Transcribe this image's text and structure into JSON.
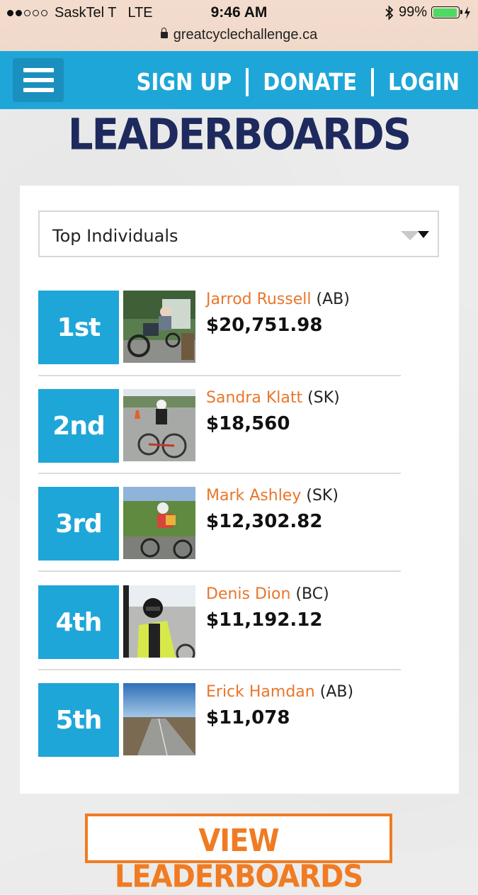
{
  "status_bar": {
    "carrier": "SaskTel T",
    "network": "LTE",
    "time": "9:46 AM",
    "battery": "99%",
    "signal_bars_filled": 2,
    "signal_bars_total": 5,
    "battery_level": 0.99
  },
  "browser": {
    "url": "greatcyclechallenge.ca"
  },
  "header": {
    "nav": {
      "signup": "SIGN UP",
      "donate": "DONATE",
      "login": "LOGIN"
    },
    "accent": "#1fa6d8"
  },
  "page": {
    "title": "LEADERBOARDS"
  },
  "filter": {
    "selected": "Top Individuals"
  },
  "leaderboard": [
    {
      "rank": "1st",
      "name": "Jarrod Russell",
      "province": "(AB)",
      "amount": "$20,751.98"
    },
    {
      "rank": "2nd",
      "name": "Sandra Klatt",
      "province": "(SK)",
      "amount": "$18,560"
    },
    {
      "rank": "3rd",
      "name": "Mark Ashley",
      "province": "(SK)",
      "amount": "$12,302.82"
    },
    {
      "rank": "4th",
      "name": "Denis Dion",
      "province": "(BC)",
      "amount": "$11,192.12"
    },
    {
      "rank": "5th",
      "name": "Erick Hamdan",
      "province": "(AB)",
      "amount": "$11,078"
    }
  ],
  "cta": {
    "label": "VIEW LEADERBOARDS",
    "color": "#f07b22"
  },
  "colors": {
    "name_link": "#e8762b",
    "title": "#1e2a5e"
  }
}
